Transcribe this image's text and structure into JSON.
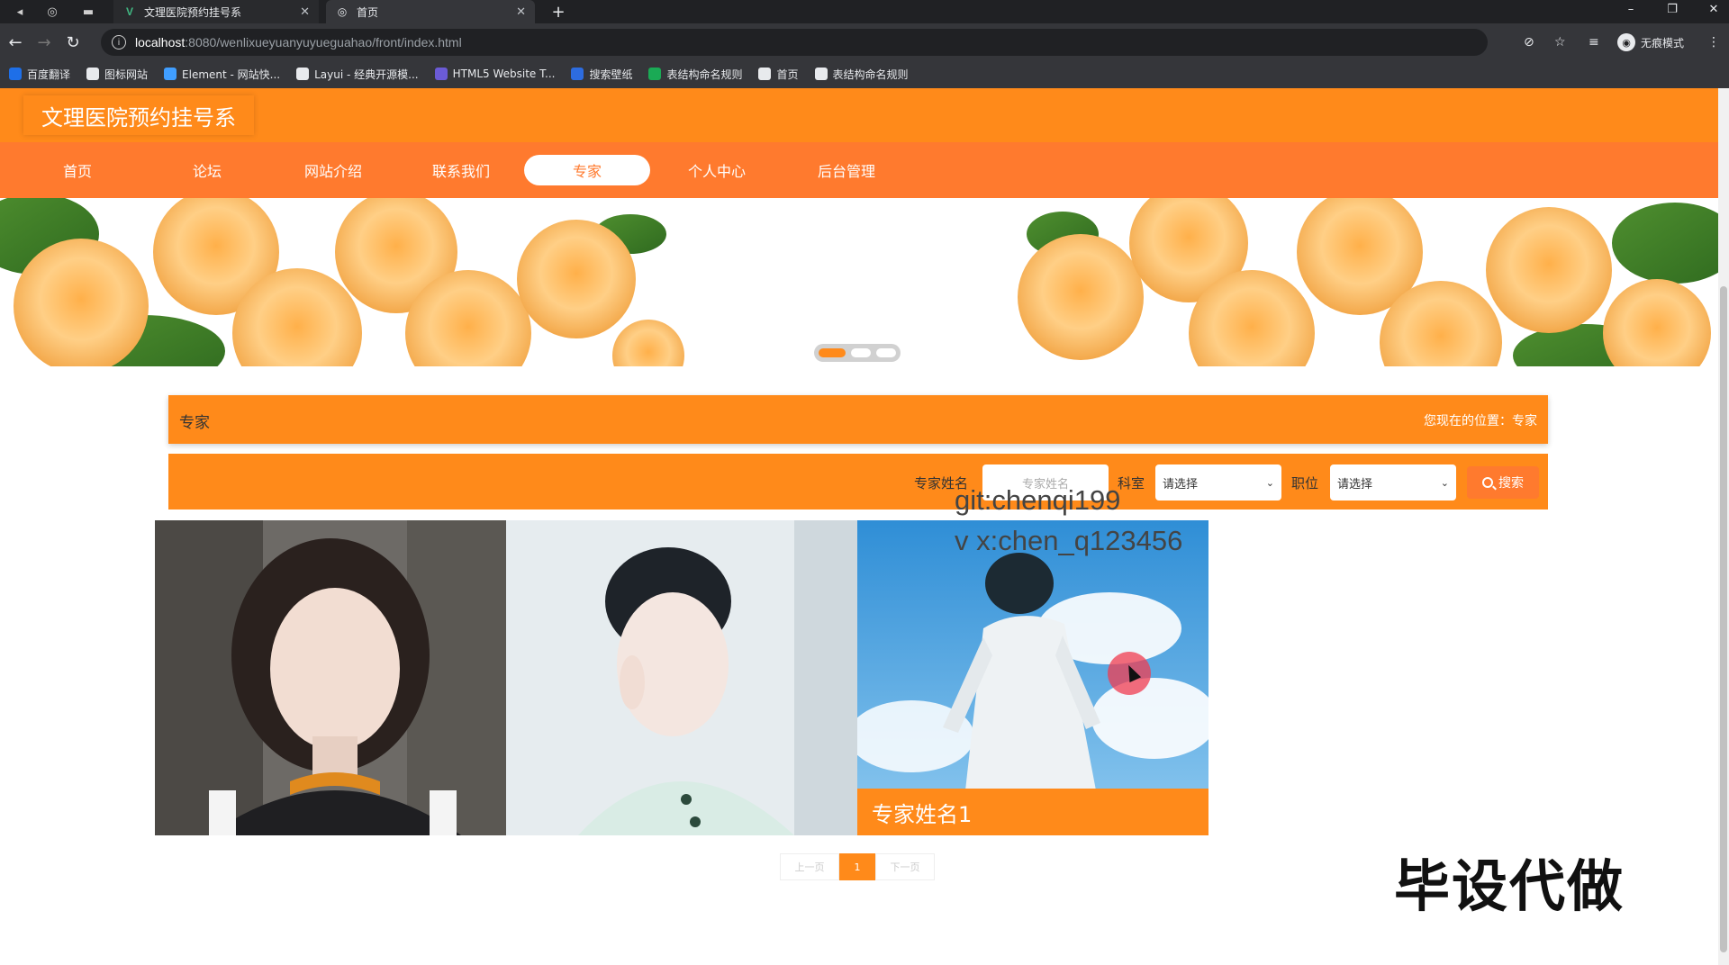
{
  "browser": {
    "tabs": [
      {
        "title": "文理医院预约挂号系"
      },
      {
        "title": "首页"
      }
    ],
    "url_host": "localhost",
    "url_path": ":8080/wenlixueyuanyuyueguahao/front/index.html",
    "profile_label": "无痕模式",
    "bookmarks": [
      {
        "label": "百度翻译",
        "color": "#1e6fe8"
      },
      {
        "label": "图标网站",
        "color": "#e8eaed"
      },
      {
        "label": "Element - 网站快...",
        "color": "#409eff"
      },
      {
        "label": "Layui - 经典开源模...",
        "color": "#e8eaed"
      },
      {
        "label": "HTML5 Website T...",
        "color": "#6b5bd6"
      },
      {
        "label": "搜索壁纸",
        "color": "#2d6cdf"
      },
      {
        "label": "表结构命名规则",
        "color": "#1aaa55"
      },
      {
        "label": "首页",
        "color": "#e8eaed"
      },
      {
        "label": "表结构命名规则",
        "color": "#e8eaed"
      }
    ]
  },
  "site": {
    "title": "文理医院预约挂号系",
    "nav": [
      {
        "label": "首页"
      },
      {
        "label": "论坛"
      },
      {
        "label": "网站介绍"
      },
      {
        "label": "联系我们"
      },
      {
        "label": "专家",
        "active": true
      },
      {
        "label": "个人中心"
      },
      {
        "label": "后台管理"
      }
    ],
    "breadcrumb": {
      "title": "专家",
      "position_label": "您现在的位置：",
      "position_value": "专家"
    },
    "search": {
      "name_label": "专家姓名",
      "name_placeholder": "专家姓名",
      "dept_label": "科室",
      "dept_value": "请选择",
      "title_label": "职位",
      "title_value": "请选择",
      "button_label": "搜索"
    },
    "cards": [
      {
        "name": ""
      },
      {
        "name": ""
      },
      {
        "name": "专家姓名1"
      }
    ],
    "pagination": {
      "prev": "上一页",
      "current": "1",
      "next": "下一页"
    }
  },
  "overlay": {
    "watermark_line1": "git:chenqi199",
    "watermark_line2": "v x:chen_q123456",
    "promo": "毕设代做"
  },
  "colors": {
    "accent": "#ff8a1a",
    "nav_bg": "#ff7a2e"
  }
}
